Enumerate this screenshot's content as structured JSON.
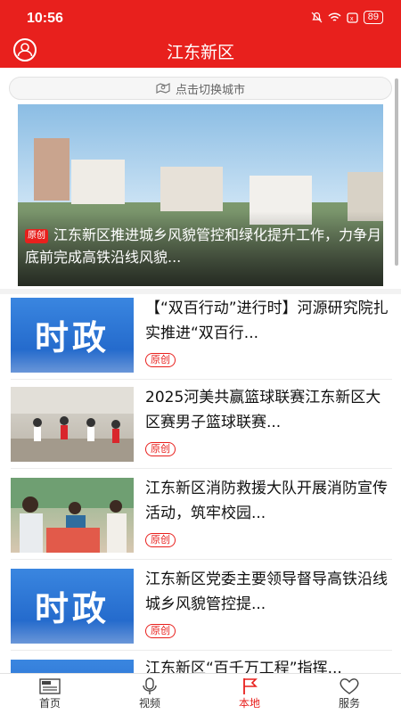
{
  "status": {
    "time": "10:56",
    "battery": "89"
  },
  "header": {
    "title": "江东新区"
  },
  "search": {
    "label": "点击切换城市"
  },
  "hero": {
    "badge": "原创",
    "caption": "江东新区推进城乡风貌管控和绿化提升工作，力争月底前完成高铁沿线风貌..."
  },
  "items": [
    {
      "title": "【“双百行动”进行时】河源研究院扎实推进“双百行...",
      "tag": "原创",
      "thumb_text": "时政"
    },
    {
      "title": "2025河美共赢篮球联赛江东新区大区赛男子篮球联赛...",
      "tag": "原创"
    },
    {
      "title": "江东新区消防救援大队开展消防宣传活动，筑牢校园...",
      "tag": "原创"
    },
    {
      "title": "江东新区党委主要领导督导高铁沿线城乡风貌管控提...",
      "tag": "原创",
      "thumb_text": "时政"
    },
    {
      "title": "江东新区“百千万工程”指挥..."
    }
  ],
  "tabs": [
    {
      "label": "首页",
      "icon": "newspaper-icon"
    },
    {
      "label": "视频",
      "icon": "microphone-icon"
    },
    {
      "label": "本地",
      "icon": "flag-icon",
      "active": true
    },
    {
      "label": "服务",
      "icon": "heart-icon"
    }
  ],
  "colors": {
    "accent": "#e8201d"
  }
}
